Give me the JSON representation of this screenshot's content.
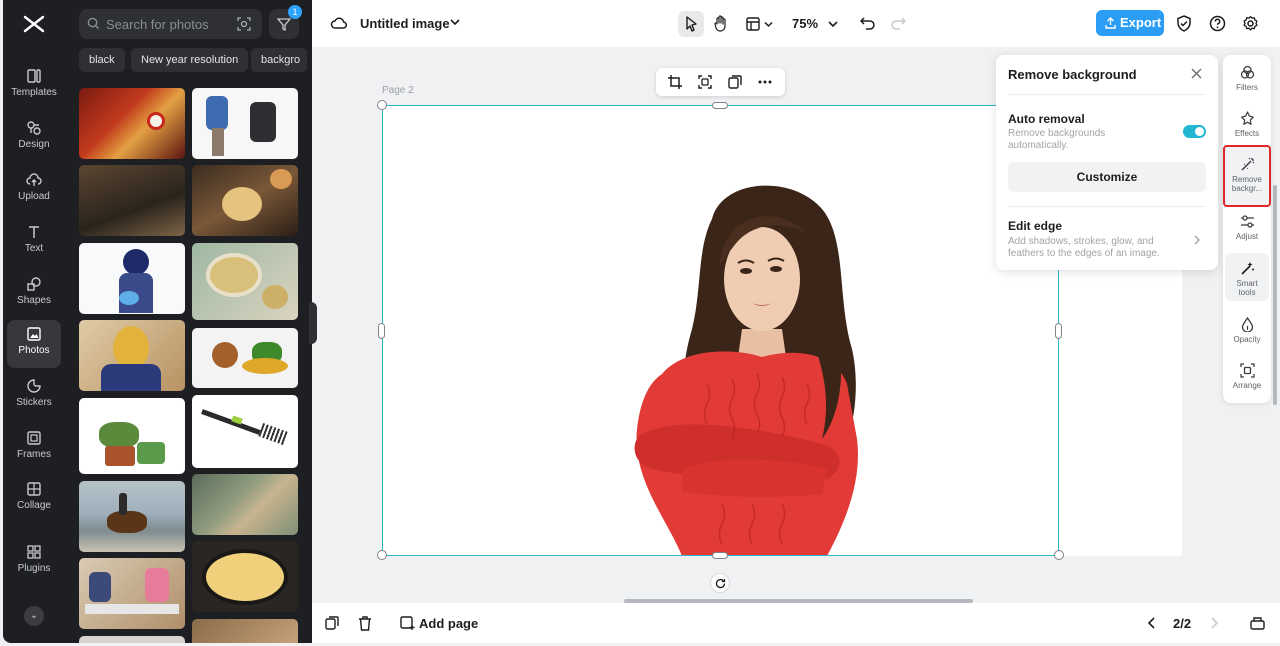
{
  "rail": {
    "items": [
      {
        "label": "Templates"
      },
      {
        "label": "Design"
      },
      {
        "label": "Upload"
      },
      {
        "label": "Text"
      },
      {
        "label": "Shapes"
      },
      {
        "label": "Photos"
      },
      {
        "label": "Stickers"
      },
      {
        "label": "Frames"
      },
      {
        "label": "Collage"
      },
      {
        "label": "Plugins"
      }
    ],
    "active": "Photos"
  },
  "panel": {
    "search_placeholder": "Search for photos",
    "filter_badge": "1",
    "chips": [
      "black",
      "New year resolution",
      "backgro"
    ]
  },
  "header": {
    "title": "Untitled image",
    "zoom": "75%",
    "export_label": "Export"
  },
  "canvas": {
    "page_label": "Page 2"
  },
  "bottom": {
    "add_page_label": "Add page",
    "page_indicator": "2/2"
  },
  "remove_bg": {
    "title": "Remove background",
    "auto_title": "Auto removal",
    "auto_desc_1": "Remove backgrounds",
    "auto_desc_2": "automatically.",
    "auto_enabled": true,
    "customize_label": "Customize",
    "edge_title": "Edit edge",
    "edge_desc_1": "Add shadows, strokes, glow, and",
    "edge_desc_2": "feathers to the edges of an image."
  },
  "tools": {
    "filters": "Filters",
    "effects": "Effects",
    "remove_bg_1": "Remove",
    "remove_bg_2": "backgr...",
    "adjust": "Adjust",
    "smart_1": "Smart",
    "smart_2": "tools",
    "opacity": "Opacity",
    "arrange": "Arrange"
  },
  "colors": {
    "accent": "#2b9df4",
    "selection": "#2bb6cf",
    "toggle": "#22b8d4",
    "highlight": "#e02828",
    "sweater": "#e23a36"
  }
}
